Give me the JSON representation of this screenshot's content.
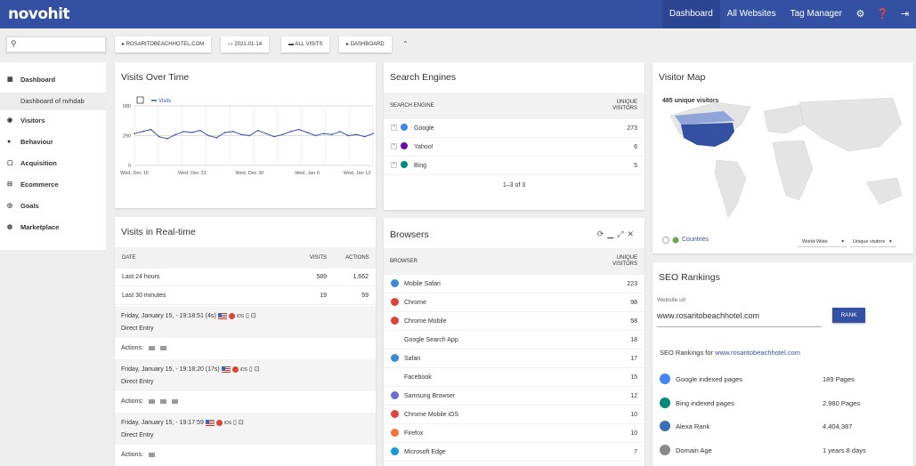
{
  "header": {
    "logo": "novohit",
    "nav": [
      "Dashboard",
      "All Websites",
      "Tag Manager"
    ],
    "icons": [
      "gear-icon",
      "help-icon",
      "logout-icon"
    ]
  },
  "search": {
    "icon": "search-icon"
  },
  "controls": {
    "site": "ROSARITOBEACHHOTEL.COM",
    "date": "2021-01-14",
    "segment": "ALL VISITS",
    "dashboard": "DASHBOARD"
  },
  "sidebar": {
    "items": [
      {
        "label": "Dashboard",
        "icon": "dashboard-icon"
      },
      {
        "label": "Dashboard of nvhdab",
        "icon": ""
      },
      {
        "label": "Visitors",
        "icon": "eye-icon"
      },
      {
        "label": "Behaviour",
        "icon": "bell-icon"
      },
      {
        "label": "Acquisition",
        "icon": "acquisition-icon"
      },
      {
        "label": "Ecommerce",
        "icon": "cart-icon"
      },
      {
        "label": "Goals",
        "icon": "goals-icon"
      },
      {
        "label": "Marketplace",
        "icon": "marketplace-icon"
      }
    ]
  },
  "visits_over_time": {
    "title": "Visits Over Time",
    "legend": "Visits",
    "chart_data": {
      "type": "line",
      "x": [
        "Wed, Dec 16",
        "Wed, Dec 23",
        "Wed, Dec 30",
        "Wed, Jan 6",
        "Wed, Jan 13"
      ],
      "yticks": [
        "580",
        "290",
        "0"
      ],
      "ylim": [
        0,
        580
      ],
      "values": [
        310,
        330,
        350,
        280,
        260,
        300,
        330,
        320,
        340,
        290,
        270,
        320,
        330,
        300,
        290,
        340,
        310,
        280,
        300,
        330,
        350,
        320,
        290,
        310,
        300,
        330,
        290,
        300,
        280,
        310
      ]
    }
  },
  "search_engines": {
    "title": "Search Engines",
    "col1": "SEARCH ENGINE",
    "col2": "UNIQUE VISITORS",
    "rows": [
      {
        "name": "Google",
        "value": "273",
        "color": "#4285f4"
      },
      {
        "name": "Yahoo!",
        "value": "6",
        "color": "#6b0fa3"
      },
      {
        "name": "Bing",
        "value": "5",
        "color": "#00897b"
      }
    ],
    "pager": "1–3 of 3"
  },
  "visitor_map": {
    "title": "Visitor Map",
    "subtitle": "485 unique visitors",
    "link": "Countries",
    "sel1": "World-Wide",
    "sel2": "Unique visitors"
  },
  "realtime": {
    "title": "Visits in Real-time",
    "cols": [
      "DATE",
      "VISITS",
      "ACTIONS"
    ],
    "rows": [
      {
        "label": "Last 24 hours",
        "visits": "589",
        "actions": "1,662"
      },
      {
        "label": "Last 30 minutes",
        "visits": "19",
        "actions": "59"
      }
    ],
    "visits": [
      {
        "time": "Friday, January 15, - 19:18:51 (4s)",
        "entry": "Direct Entry",
        "actions": "Actions:",
        "os": "iOS"
      },
      {
        "time": "Friday, January 15, - 19:18:20 (17s)",
        "entry": "Direct Entry",
        "actions": "Actions:",
        "os": "iOS"
      },
      {
        "time": "Friday, January 15, - 19:17:59",
        "entry": "Direct Entry",
        "actions": "Actions:",
        "os": "iOS"
      }
    ]
  },
  "browsers": {
    "title": "Browsers",
    "col1": "BROWSER",
    "col2": "UNIQUE VISITORS",
    "rows": [
      {
        "name": "Mobile Safari",
        "value": "223",
        "color": "#3b8ad9"
      },
      {
        "name": "Chrome",
        "value": "98",
        "color": "#db4437"
      },
      {
        "name": "Chrome Mobile",
        "value": "58",
        "color": "#db4437"
      },
      {
        "name": "Google Search App",
        "value": "18",
        "color": ""
      },
      {
        "name": "Safari",
        "value": "17",
        "color": "#3b8ad9"
      },
      {
        "name": "Facebook",
        "value": "15",
        "color": ""
      },
      {
        "name": "Samsung Browser",
        "value": "12",
        "color": "#6b6bd6"
      },
      {
        "name": "Chrome Mobile iOS",
        "value": "10",
        "color": "#db4437"
      },
      {
        "name": "Firefox",
        "value": "10",
        "color": "#ff7139"
      },
      {
        "name": "Microsoft Edge",
        "value": "7",
        "color": "#0f9bd7"
      }
    ]
  },
  "seo": {
    "title": "SEO Rankings",
    "url_label": "Website url",
    "url": "www.rosaritobeachhotel.com",
    "button": "RANK",
    "for_label": "SEO Rankings for",
    "for_link": "www.rosaritobeachhotel.com",
    "rows": [
      {
        "label": "Google indexed pages",
        "value": "189 Pages",
        "color": "#4285f4"
      },
      {
        "label": "Bing indexed pages",
        "value": "2,980 Pages",
        "color": "#00897b"
      },
      {
        "label": "Alexa Rank",
        "value": "4,404,387",
        "color": "#3a6fb7"
      },
      {
        "label": "Domain Age",
        "value": "1 years 8 days",
        "color": "#8a8a8a"
      }
    ]
  }
}
